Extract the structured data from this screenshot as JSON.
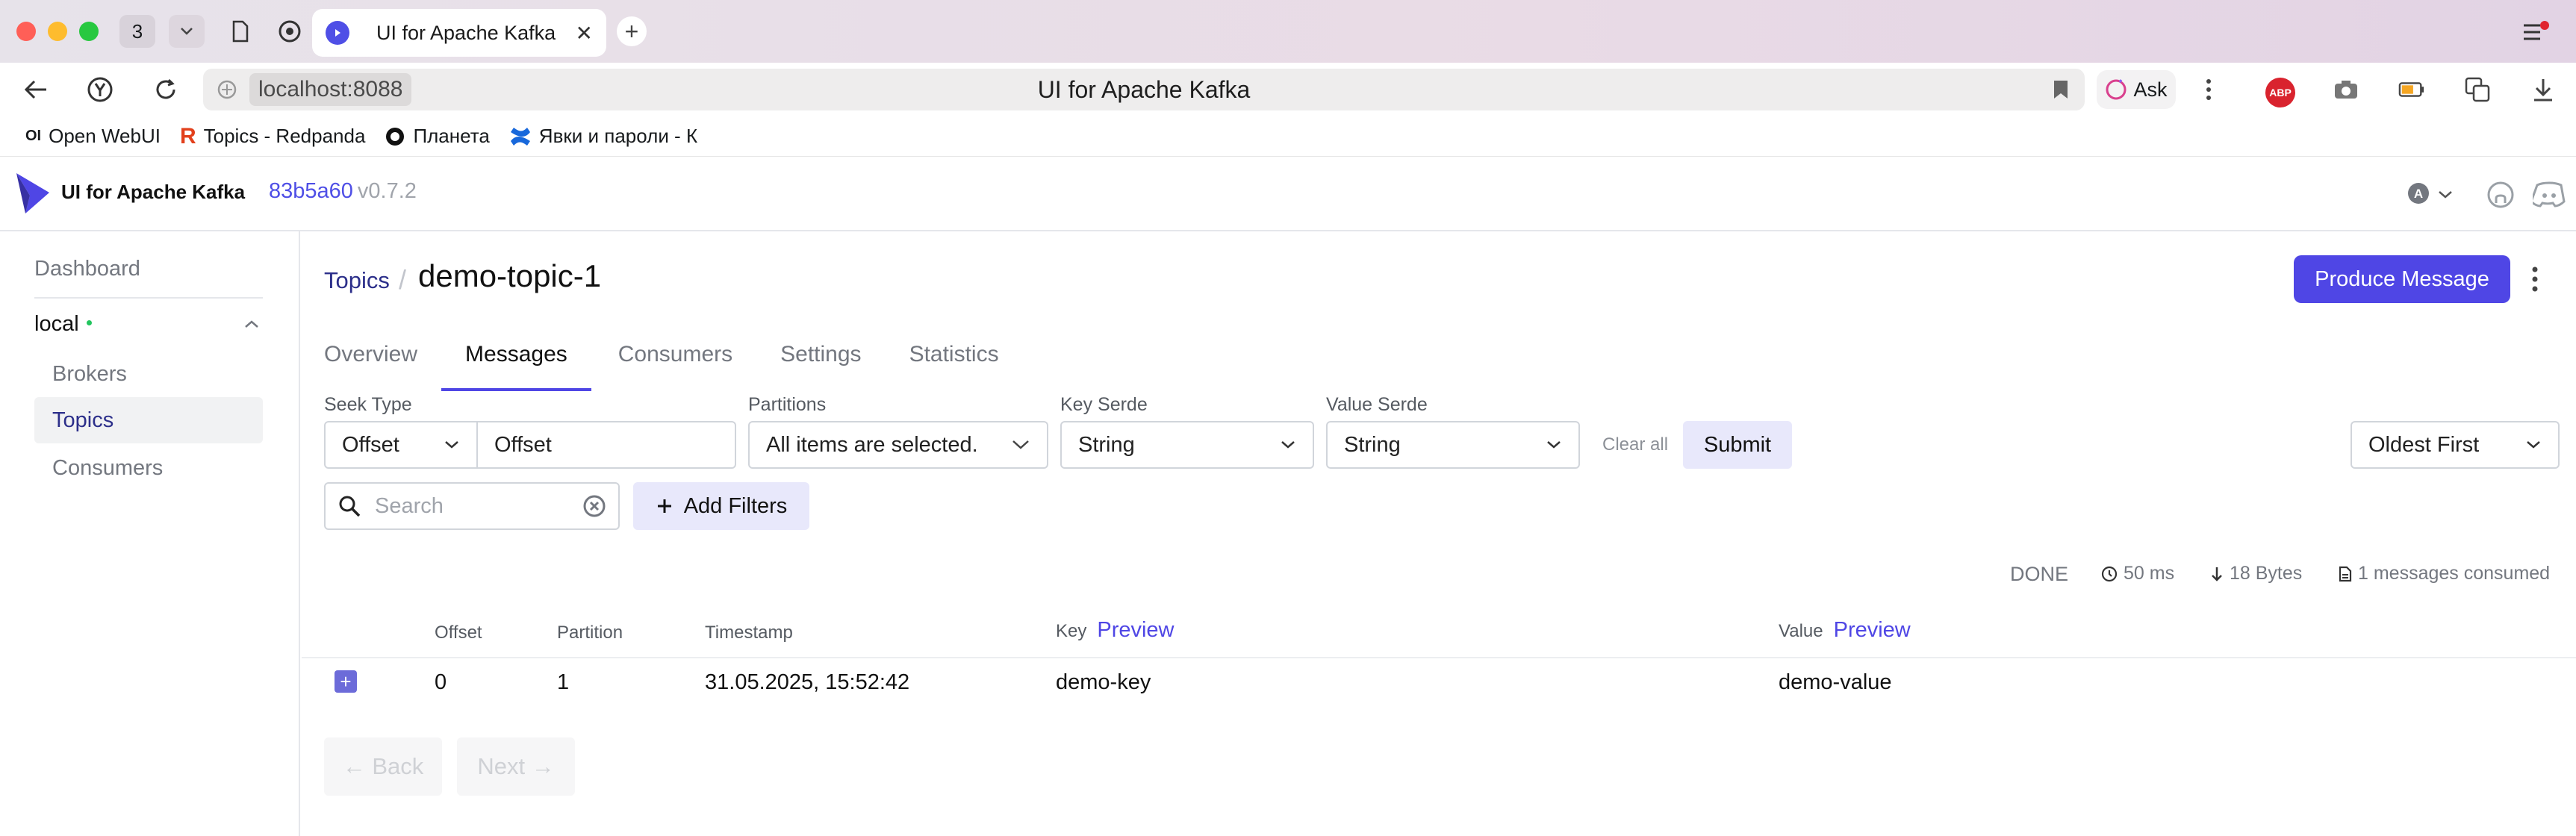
{
  "browser": {
    "tab_count": "3",
    "active_tab_title": "UI for Apache Kafka",
    "address_host": "localhost:8088",
    "address_title": "UI for Apache Kafka",
    "ask_label": "Ask",
    "abp_label": "ABP",
    "bookmarks": [
      {
        "label": "Open WebUI",
        "icon": "openwebui-icon"
      },
      {
        "label": "Topics - Redpanda",
        "icon": "redpanda-icon"
      },
      {
        "label": "Планета",
        "icon": "planet-icon"
      },
      {
        "label": "Явки и пароли - К",
        "icon": "confluence-icon"
      }
    ]
  },
  "app": {
    "name": "UI for Apache Kafka",
    "commit": "83b5a60",
    "version": "v0.7.2",
    "user_initial": "A"
  },
  "sidebar": {
    "dashboard": "Dashboard",
    "cluster": "local",
    "cluster_status_color": "#22c55e",
    "items": [
      {
        "label": "Brokers",
        "active": false
      },
      {
        "label": "Topics",
        "active": true
      },
      {
        "label": "Consumers",
        "active": false
      }
    ]
  },
  "page": {
    "breadcrumb": "Topics",
    "breadcrumb_sep": "/",
    "topic_name": "demo-topic-1",
    "produce_label": "Produce Message",
    "tabs": [
      {
        "label": "Overview"
      },
      {
        "label": "Messages",
        "active": true
      },
      {
        "label": "Consumers"
      },
      {
        "label": "Settings"
      },
      {
        "label": "Statistics"
      }
    ]
  },
  "filters": {
    "seek_type_label": "Seek Type",
    "seek_type_value": "Offset",
    "offset_value": "Offset",
    "partitions_label": "Partitions",
    "partitions_value": "All items are selected.",
    "key_serde_label": "Key Serde",
    "key_serde_value": "String",
    "value_serde_label": "Value Serde",
    "value_serde_value": "String",
    "clear_all": "Clear all",
    "submit": "Submit",
    "sort_value": "Oldest First",
    "search_placeholder": "Search",
    "add_filters": "Add Filters"
  },
  "status": {
    "state": "DONE",
    "elapsed": "50 ms",
    "bytes": "18 Bytes",
    "consumed": "1 messages consumed"
  },
  "table": {
    "headers": {
      "offset": "Offset",
      "partition": "Partition",
      "timestamp": "Timestamp",
      "key": "Key",
      "value": "Value",
      "preview": "Preview"
    },
    "rows": [
      {
        "offset": "0",
        "partition": "1",
        "timestamp": "31.05.2025, 15:52:42",
        "key": "demo-key",
        "value": "demo-value"
      }
    ]
  },
  "pagination": {
    "back": "← Back",
    "next": "Next →"
  },
  "colors": {
    "accent": "#4f46e5",
    "link": "#2c2f8a"
  }
}
